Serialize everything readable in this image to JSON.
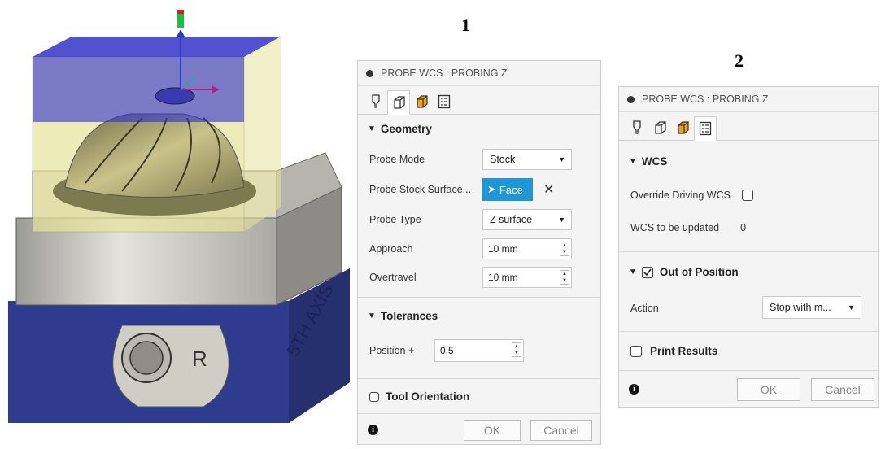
{
  "labels": {
    "one": "1",
    "two": "2"
  },
  "viewport": {
    "engraving_letter": "R",
    "engraving_text": "5TH AXIS"
  },
  "panel1": {
    "title": "PROBE WCS : PROBING Z",
    "tabs": [
      "tool-tab",
      "geometry-tab",
      "heights-tab",
      "settings-tab"
    ],
    "active_tab": 1,
    "geometry": {
      "heading": "Geometry",
      "probe_mode_label": "Probe Mode",
      "probe_mode_value": "Stock",
      "stock_surface_label": "Probe Stock Surface...",
      "stock_surface_value": "Face",
      "probe_type_label": "Probe Type",
      "probe_type_value": "Z surface",
      "approach_label": "Approach",
      "approach_value": "10 mm",
      "overtravel_label": "Overtravel",
      "overtravel_value": "10 mm"
    },
    "tolerances": {
      "heading": "Tolerances",
      "position_label": "Position +-",
      "position_value": "0,5"
    },
    "tool_orientation_label": "Tool Orientation",
    "ok_label": "OK",
    "cancel_label": "Cancel"
  },
  "panel2": {
    "title": "PROBE WCS : PROBING Z",
    "active_tab": 3,
    "wcs": {
      "heading": "WCS",
      "override_label": "Override Driving WCS",
      "override_checked": false,
      "wcs_updated_label": "WCS to be updated",
      "wcs_updated_value": "0"
    },
    "out_of_position": {
      "heading": "Out of Position",
      "checked": true,
      "action_label": "Action",
      "action_value": "Stop with m..."
    },
    "print_results_label": "Print Results",
    "ok_label": "OK",
    "cancel_label": "Cancel"
  },
  "colors": {
    "stock_blue": "#3a3acc",
    "stock_yellow": "#e8e49a",
    "vise_base": "#2e3a8c",
    "accent": "#1f97d6"
  }
}
